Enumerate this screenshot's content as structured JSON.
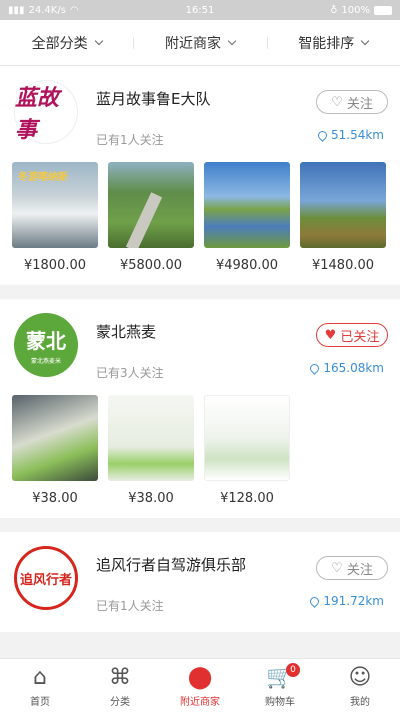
{
  "status_bar": {
    "signal": "24.4K/s",
    "time": "16:51",
    "battery": "100%"
  },
  "filters": [
    {
      "label": "全部分类"
    },
    {
      "label": "附近商家"
    },
    {
      "label": "智能排序"
    }
  ],
  "shops": [
    {
      "logo_text": "蓝故事",
      "name": "蓝月故事鲁E大队",
      "fans": "已有1人关注",
      "follow_label": "关注",
      "followed": false,
      "distance": "51.54km",
      "products": [
        {
          "price": "¥1800.00",
          "thumb_caption": "冬游喀纳斯"
        },
        {
          "price": "¥5800.00",
          "thumb_caption": ""
        },
        {
          "price": "¥4980.00",
          "thumb_caption": ""
        },
        {
          "price": "¥1480.00",
          "thumb_caption": ""
        }
      ]
    },
    {
      "logo_text": "蒙北",
      "logo_sub": "蒙北燕麦米",
      "name": "蒙北燕麦",
      "fans": "已有3人关注",
      "follow_label": "已关注",
      "followed": true,
      "distance": "165.08km",
      "products": [
        {
          "price": "¥38.00"
        },
        {
          "price": "¥38.00"
        },
        {
          "price": "¥128.00"
        }
      ]
    },
    {
      "logo_text": "追风行者",
      "name": "追风行者自驾游俱乐部",
      "fans": "已有1人关注",
      "follow_label": "关注",
      "followed": false,
      "distance": "191.72km"
    }
  ],
  "tabbar": [
    {
      "label": "首页",
      "icon": "home-icon",
      "glyph": "⌂"
    },
    {
      "label": "分类",
      "icon": "category-icon",
      "glyph": "⌘"
    },
    {
      "label": "附近商家",
      "icon": "location-icon",
      "glyph": "⬤"
    },
    {
      "label": "购物车",
      "icon": "cart-icon",
      "glyph": "🛒",
      "badge": "0"
    },
    {
      "label": "我的",
      "icon": "user-icon",
      "glyph": "☺"
    }
  ],
  "colors": {
    "accent": "#e0302f",
    "distance": "#3a8ed6"
  }
}
